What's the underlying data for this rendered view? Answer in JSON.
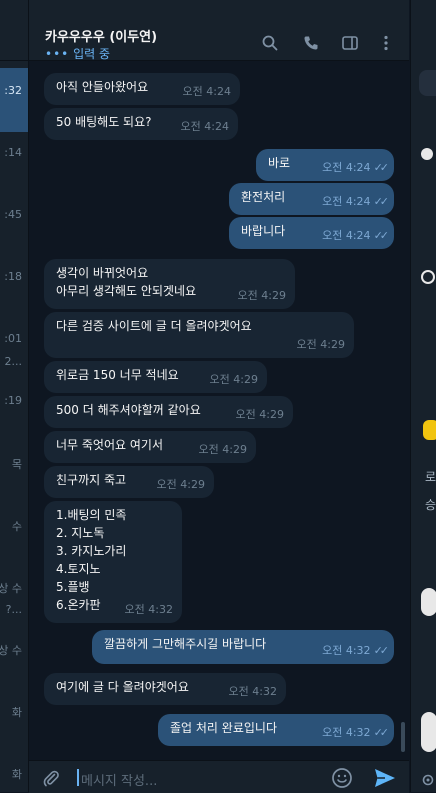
{
  "left_list": {
    "times": [
      ":32",
      ":14",
      ":45",
      ":18",
      ":01",
      "2...",
      ":19",
      "목",
      "수",
      "상 수",
      "?...",
      "상 수",
      "화",
      "화"
    ]
  },
  "header": {
    "title": "카우우우우 (이두연)",
    "status": "입력 중"
  },
  "messages": [
    {
      "dir": "in",
      "text": "아직 안들아왔어요",
      "time": "오전 4:24"
    },
    {
      "dir": "in",
      "text": "50 배팅해도 되요?",
      "time": "오전 4:24"
    },
    {
      "dir": "out",
      "text": "바로",
      "time": "오전 4:24"
    },
    {
      "dir": "out",
      "text": "환전처리",
      "time": "오전 4:24"
    },
    {
      "dir": "out",
      "text": "바랍니다",
      "time": "오전 4:24"
    },
    {
      "dir": "in",
      "text": "생각이 바뀌엇어요\n아무리 생각해도 안되겟네요",
      "time": "오전 4:29"
    },
    {
      "dir": "in",
      "text": "다른 검증 사이트에 글 더 올려야겟어요",
      "time": "오전 4:29"
    },
    {
      "dir": "in",
      "text": "위로금 150 너무 적네요",
      "time": "오전 4:29"
    },
    {
      "dir": "in",
      "text": "500 더 해주셔야할꺼 같아요",
      "time": "오전 4:29"
    },
    {
      "dir": "in",
      "text": "너무 죽엇어요 여기서",
      "time": "오전 4:29"
    },
    {
      "dir": "in",
      "text": "친구까지 죽고",
      "time": "오전 4:29"
    },
    {
      "dir": "in",
      "text": "1.배팅의 민족\n2. 지노독\n3. 카지노가리\n4.토지노\n5.플뱅\n6.온카판",
      "time": "오전 4:32"
    },
    {
      "dir": "out",
      "text": "깔끔하게 그만해주시길 바랍니다",
      "time": "오전 4:32"
    },
    {
      "dir": "in",
      "text": "여기에 글 다 올려야겟어요",
      "time": "오전 4:32"
    },
    {
      "dir": "out",
      "text": "졸업 처리 완료입니다",
      "time": "오전 4:32"
    }
  ],
  "composer": {
    "placeholder": "메시지 작성..."
  },
  "right_panel": {
    "labels": [
      "로",
      "승"
    ]
  },
  "colors": {
    "background": "#0e1621",
    "panel": "#17212b",
    "incoming_bubble": "#182533",
    "outgoing_bubble": "#2b5278",
    "accent": "#5eb5f7"
  }
}
